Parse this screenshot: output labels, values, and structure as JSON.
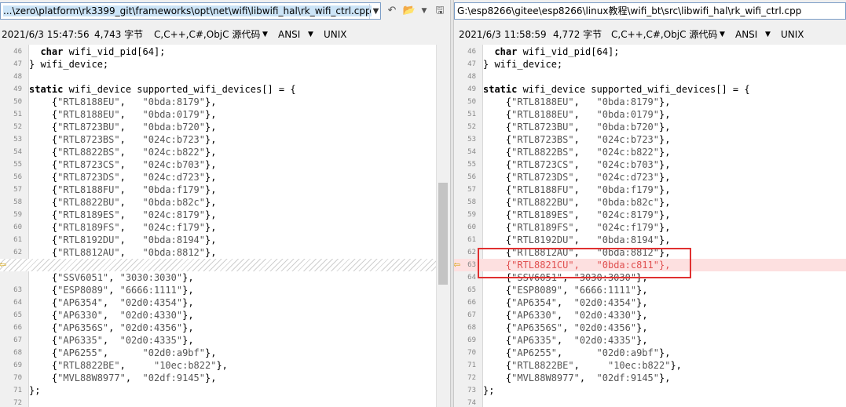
{
  "left": {
    "path": "...\\zero\\platform\\rk3399_git\\frameworks\\opt\\net\\wifi\\libwifi_hal\\rk_wifi_ctrl.cpp",
    "dropdown_icon": "chevron-down-icon",
    "datetime": "2021/6/3 15:47:56",
    "size": "4,743 字节",
    "filetype": "C,C++,C#,ObjC 源代码",
    "encoding": "ANSI",
    "line_ending": "UNIX",
    "lines": [
      {
        "n": "46",
        "text": "  char wifi_vid_pid[64];"
      },
      {
        "n": "47",
        "text": "} wifi_device;"
      },
      {
        "n": "48",
        "text": ""
      },
      {
        "n": "49",
        "text": "static wifi_device supported_wifi_devices[] = {"
      },
      {
        "n": "50",
        "text": "    {\"RTL8188EU\",   \"0bda:8179\"},"
      },
      {
        "n": "51",
        "text": "    {\"RTL8188EU\",   \"0bda:0179\"},"
      },
      {
        "n": "52",
        "text": "    {\"RTL8723BU\",   \"0bda:b720\"},"
      },
      {
        "n": "53",
        "text": "    {\"RTL8723BS\",   \"024c:b723\"},"
      },
      {
        "n": "54",
        "text": "    {\"RTL8822BS\",   \"024c:b822\"},"
      },
      {
        "n": "55",
        "text": "    {\"RTL8723CS\",   \"024c:b703\"},"
      },
      {
        "n": "56",
        "text": "    {\"RTL8723DS\",   \"024c:d723\"},"
      },
      {
        "n": "57",
        "text": "    {\"RTL8188FU\",   \"0bda:f179\"},"
      },
      {
        "n": "58",
        "text": "    {\"RTL8822BU\",   \"0bda:b82c\"},"
      },
      {
        "n": "59",
        "text": "    {\"RTL8189ES\",   \"024c:8179\"},"
      },
      {
        "n": "60",
        "text": "    {\"RTL8189FS\",   \"024c:f179\"},"
      },
      {
        "n": "61",
        "text": "    {\"RTL8192DU\",   \"0bda:8194\"},"
      },
      {
        "n": "62",
        "text": "    {\"RTL8812AU\",   \"0bda:8812\"},"
      },
      {
        "n": "",
        "text": "",
        "placeholder": true
      },
      {
        "n": "",
        "text": "    {\"SSV6051\", \"3030:3030\"},"
      },
      {
        "n": "63",
        "text": "    {\"ESP8089\", \"6666:1111\"},"
      },
      {
        "n": "64",
        "text": "    {\"AP6354\",  \"02d0:4354\"},"
      },
      {
        "n": "65",
        "text": "    {\"AP6330\",  \"02d0:4330\"},"
      },
      {
        "n": "66",
        "text": "    {\"AP6356S\", \"02d0:4356\"},"
      },
      {
        "n": "67",
        "text": "    {\"AP6335\",  \"02d0:4335\"},"
      },
      {
        "n": "68",
        "text": "    {\"AP6255\",      \"02d0:a9bf\"},"
      },
      {
        "n": "69",
        "text": "    {\"RTL8822BE\",     \"10ec:b822\"},"
      },
      {
        "n": "70",
        "text": "    {\"MVL88W8977\",  \"02df:9145\"},"
      },
      {
        "n": "71",
        "text": "};"
      },
      {
        "n": "72",
        "text": ""
      }
    ]
  },
  "right": {
    "path": "G:\\esp8266\\gitee\\esp8266\\linux教程\\wifi_bt\\src\\libwifi_hal\\rk_wifi_ctrl.cpp",
    "datetime": "2021/6/3 11:58:59",
    "size": "4,772 字节",
    "filetype": "C,C++,C#,ObjC 源代码",
    "encoding": "ANSI",
    "line_ending": "UNIX",
    "lines": [
      {
        "n": "46",
        "text": "  char wifi_vid_pid[64];"
      },
      {
        "n": "47",
        "text": "} wifi_device;"
      },
      {
        "n": "48",
        "text": ""
      },
      {
        "n": "49",
        "text": "static wifi_device supported_wifi_devices[] = {"
      },
      {
        "n": "50",
        "text": "    {\"RTL8188EU\",   \"0bda:8179\"},"
      },
      {
        "n": "51",
        "text": "    {\"RTL8188EU\",   \"0bda:0179\"},"
      },
      {
        "n": "52",
        "text": "    {\"RTL8723BU\",   \"0bda:b720\"},"
      },
      {
        "n": "53",
        "text": "    {\"RTL8723BS\",   \"024c:b723\"},"
      },
      {
        "n": "54",
        "text": "    {\"RTL8822BS\",   \"024c:b822\"},"
      },
      {
        "n": "55",
        "text": "    {\"RTL8723CS\",   \"024c:b703\"},"
      },
      {
        "n": "56",
        "text": "    {\"RTL8723DS\",   \"024c:d723\"},"
      },
      {
        "n": "57",
        "text": "    {\"RTL8188FU\",   \"0bda:f179\"},"
      },
      {
        "n": "58",
        "text": "    {\"RTL8822BU\",   \"0bda:b82c\"},"
      },
      {
        "n": "59",
        "text": "    {\"RTL8189ES\",   \"024c:8179\"},"
      },
      {
        "n": "60",
        "text": "    {\"RTL8189FS\",   \"024c:f179\"},"
      },
      {
        "n": "61",
        "text": "    {\"RTL8192DU\",   \"0bda:8194\"},"
      },
      {
        "n": "62",
        "text": "    {\"RTL8812AU\",   \"0bda:8812\"},"
      },
      {
        "n": "63",
        "text": "    {\"RTL8821CU\",   \"0bda:c811\"},",
        "changed": true
      },
      {
        "n": "64",
        "text": "    {\"SSV6051\", \"3030:3030\"},"
      },
      {
        "n": "65",
        "text": "    {\"ESP8089\", \"6666:1111\"},"
      },
      {
        "n": "66",
        "text": "    {\"AP6354\",  \"02d0:4354\"},"
      },
      {
        "n": "67",
        "text": "    {\"AP6330\",  \"02d0:4330\"},"
      },
      {
        "n": "68",
        "text": "    {\"AP6356S\", \"02d0:4356\"},"
      },
      {
        "n": "69",
        "text": "    {\"AP6335\",  \"02d0:4335\"},"
      },
      {
        "n": "70",
        "text": "    {\"AP6255\",      \"02d0:a9bf\"},"
      },
      {
        "n": "71",
        "text": "    {\"RTL8822BE\",     \"10ec:b822\"},"
      },
      {
        "n": "72",
        "text": "    {\"MVL88W8977\",  \"02df:9145\"},"
      },
      {
        "n": "73",
        "text": "};"
      },
      {
        "n": "74",
        "text": ""
      }
    ]
  },
  "toolbar_icons": [
    "undo-icon",
    "open-folder-icon",
    "chevron-down-icon",
    "save-icon"
  ],
  "colors": {
    "diff_text": "#e05050",
    "diff_bg": "#fde0e0",
    "highlight_box": "#e03030",
    "path_select": "#cce4f7"
  }
}
